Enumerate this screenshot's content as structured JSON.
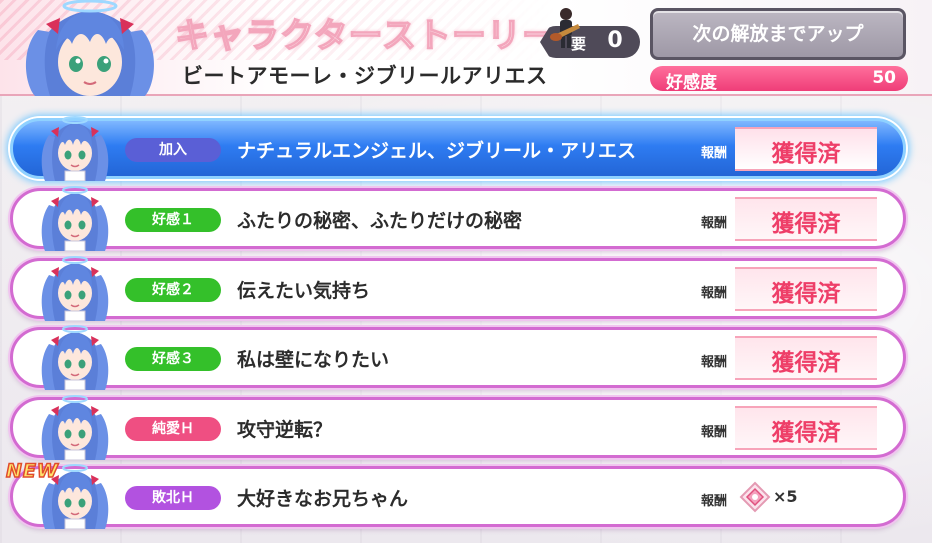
{
  "header": {
    "screen_title": "キャラクターストーリー",
    "character_name": "ビートアモーレ・ジブリールアリエス",
    "requirement_label": "要",
    "requirement_value": "0",
    "unlock_button_label": "次の解放までアップ",
    "affinity_label": "好感度",
    "affinity_value": "50"
  },
  "colors": {
    "join_tag": "#5a5fd6",
    "affinity_tag": "#34c02a",
    "pure_love_tag": "#ef4f82",
    "defeat_tag": "#b252e0",
    "obtained_text": "#ee3e68"
  },
  "reward_label": "報酬",
  "obtained_text": "獲得済",
  "stories": [
    {
      "tag": "加入",
      "tag_color": "#5a5fd6",
      "title": "ナチュラルエンジェル、ジブリール・アリエス",
      "status": "獲得済",
      "selected": true
    },
    {
      "tag": "好感１",
      "tag_color": "#34c02a",
      "title": "ふたりの秘密、ふたりだけの秘密",
      "status": "獲得済",
      "selected": false
    },
    {
      "tag": "好感２",
      "tag_color": "#34c02a",
      "title": "伝えたい気持ち",
      "status": "獲得済",
      "selected": false
    },
    {
      "tag": "好感３",
      "tag_color": "#34c02a",
      "title": "私は壁になりたい",
      "status": "獲得済",
      "selected": false
    },
    {
      "tag": "純愛Ｈ",
      "tag_color": "#ef4f82",
      "title": "攻守逆転？",
      "status": "獲得済",
      "selected": false
    },
    {
      "tag": "敗北Ｈ",
      "tag_color": "#b252e0",
      "title": "大好きなお兄ちゃん",
      "reward_icon": "gem-icon",
      "reward_qty": "×5",
      "is_new": true,
      "new_label": "NEW",
      "selected": false
    }
  ]
}
